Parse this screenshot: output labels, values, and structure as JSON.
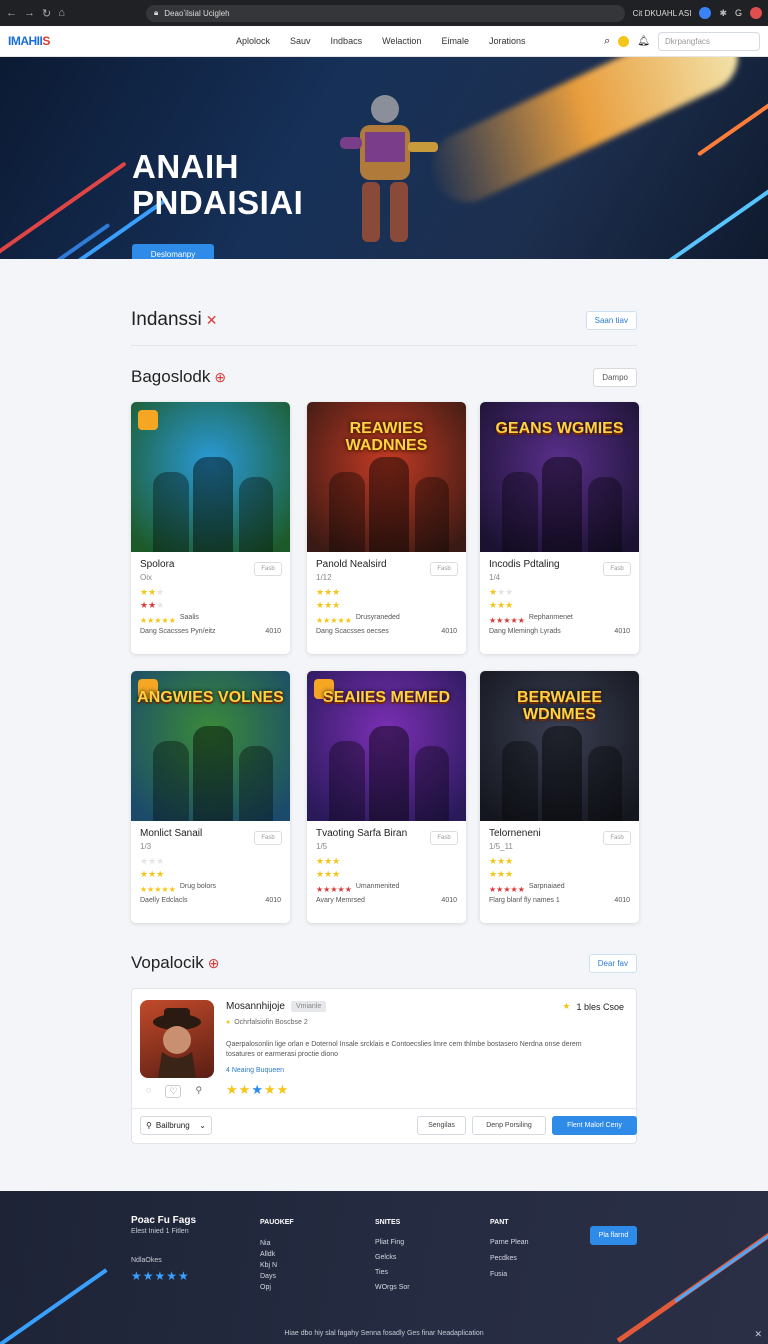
{
  "browser": {
    "url": "Deaoʼilsial Ucigleh",
    "profile_label": "Cit DKUAHL ASI"
  },
  "nav": {
    "logo_main": "IMAHII",
    "logo_accent": "S",
    "items": [
      "Aplolock",
      "Sauv",
      "Indbacs",
      "Welaction",
      "Eimale",
      "Jorations"
    ],
    "search_placeholder": "Dkrpangfacs"
  },
  "hero": {
    "title_line1": "ANAIH",
    "title_line2": "PNDAISIAI",
    "cta_label": "Deslomanpy"
  },
  "section_indanssi": {
    "title": "Indanssi",
    "button": "Saan tiav"
  },
  "section_bagoslodk": {
    "title": "Bagoslodk",
    "button": "Dampo",
    "cards": [
      {
        "title": "",
        "name": "Spolora",
        "sub": "Oix",
        "tag": "Fasb",
        "meta1": "Saalis",
        "meta2_l": "Dang Scacsses",
        "meta2_c": "Pyn/eitz",
        "meta2_r": "4010",
        "stars_a": 2,
        "stars_b": 2,
        "stars_c": 5,
        "accent": "#2a9ad8"
      },
      {
        "title": "REAWIES WADNNES",
        "name": "Panold Nealsird",
        "sub": "1/12",
        "tag": "Fasb",
        "meta1": "Drusyraneded",
        "meta2_l": "Dang Scacsses",
        "meta2_c": "oecses",
        "meta2_r": "4010",
        "stars_a": 3,
        "stars_b": 3,
        "stars_c": 5,
        "accent": "#c23a24"
      },
      {
        "title": "GEANS WGMIES",
        "name": "Incodis Pdtaling",
        "sub": "1/4",
        "tag": "Fasb",
        "meta1": "Rephanmenet",
        "meta2_l": "Dang Mlemingh",
        "meta2_c": "Lyrads",
        "meta2_r": "4010",
        "stars_a": 1,
        "stars_b": 3,
        "stars_c": 5,
        "accent": "#5a2f8c"
      },
      {
        "title": "ANGWIES VOLNES",
        "name": "Monlict Sanail",
        "sub": "1/3",
        "tag": "Fasb",
        "meta1": "Drug bolors",
        "meta2_l": "Daelly Edclacls",
        "meta2_c": "",
        "meta2_r": "4010",
        "stars_a": 0,
        "stars_b": 3,
        "stars_c": 5,
        "accent": "#3a8a3a"
      },
      {
        "title": "SEAIIES MEMED",
        "name": "Tvaoting Sarfa Biran",
        "sub": "1/5",
        "tag": "Fasb",
        "meta1": "Umanmenited",
        "meta2_l": "Avary Memrsed",
        "meta2_c": "",
        "meta2_r": "4010",
        "stars_a": 3,
        "stars_b": 3,
        "stars_c": 5,
        "accent": "#7b2fb5"
      },
      {
        "title": "BERWAIEE WDNMES",
        "name": "Telorneneni",
        "sub": "1/5_11",
        "tag": "Fasb",
        "meta1": "Sarpnaiaed",
        "meta2_l": "Flarg blanf",
        "meta2_c": "fly names 1",
        "meta2_r": "4010",
        "stars_a": 3,
        "stars_b": 3,
        "stars_c": 5,
        "accent": "#3a3f52"
      }
    ]
  },
  "section_vopalocik": {
    "title": "Vopalocik",
    "button": "Dear fav",
    "review": {
      "name": "Mosannhijoje",
      "chip": "Vmianle",
      "verified": "Ochrfalsiofin Boscbse 2",
      "rating_label": "1 bles Csoe",
      "text": "Qaerpalosonlin lige orlan e Doternol Insale srcklais e Contoecslies lmre cem thlmbe bostasero Nerdna onse derem tosatures or earmerasi proctie diono",
      "link": "4 Neaing Buqueen",
      "stars": 5,
      "dropdown": "Bailbrung",
      "btn1": "Sengilas",
      "btn2": "Denp Porsiling",
      "btn3": "Flent Malorl Ceny"
    }
  },
  "footer": {
    "brand": "Poac Fu Fags",
    "brand_sub": "Elest Inied 1 Fitlen",
    "brand_note": "NdlaOkes",
    "stars": 5,
    "cols": [
      {
        "title": "PAUOKEF",
        "items": [
          "Nia",
          "Alldk",
          "Kbj N",
          "Days",
          "Opj"
        ]
      },
      {
        "title": "SNITES",
        "items": [
          "Pliat Fing",
          "Gelcks",
          "Ties",
          "WOrgs Sor"
        ]
      },
      {
        "title": "PANT",
        "items": [
          "Parne Plean",
          "Pecdkes",
          "Fusia"
        ]
      }
    ],
    "cta": "Pla flarnd",
    "bottom": "Hiae dbo hiy slal fagahy Senna fosadly Ges finar Neadaplication"
  },
  "colors": {
    "primary": "#2e8be8",
    "star": "#f5c518",
    "star_red": "#d93a3a",
    "footer_bg": "#232a3d"
  }
}
